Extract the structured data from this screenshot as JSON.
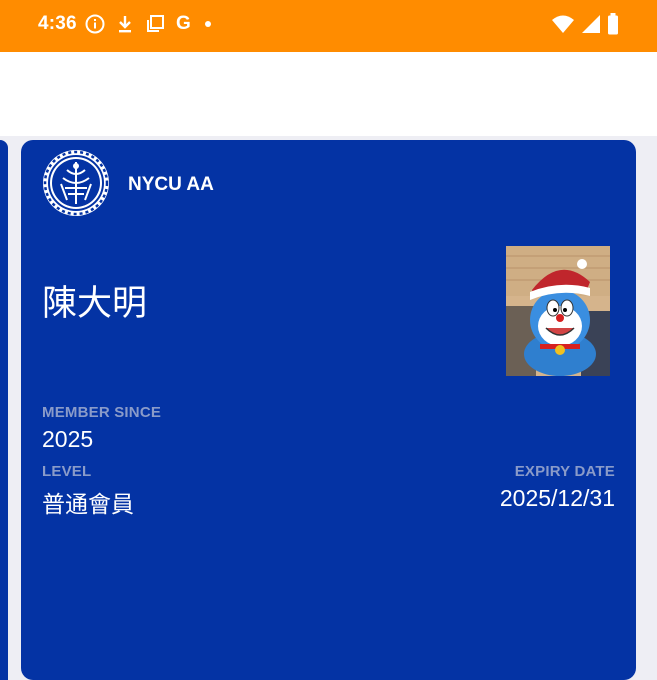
{
  "status_bar": {
    "time": "4:36",
    "icons_left": [
      "info-icon",
      "download-icon",
      "copy-icon",
      "google-g-icon",
      "notification-dot-icon"
    ],
    "icons_right": [
      "wifi-icon",
      "signal-icon",
      "battery-icon"
    ],
    "google_letter": "G"
  },
  "colors": {
    "status_bar_bg": "#ff8c00",
    "card_bg": "#0433a4",
    "label_color": "#8a9bc9",
    "page_bg": "#eeeef4"
  },
  "card": {
    "org_name": "NYCU AA",
    "member_name": "陳大明",
    "member_since_label": "MEMBER SINCE",
    "member_since_value": "2025",
    "level_label": "LEVEL",
    "level_value": "普通會員",
    "expiry_label": "EXPIRY DATE",
    "expiry_value": "2025/12/31"
  }
}
